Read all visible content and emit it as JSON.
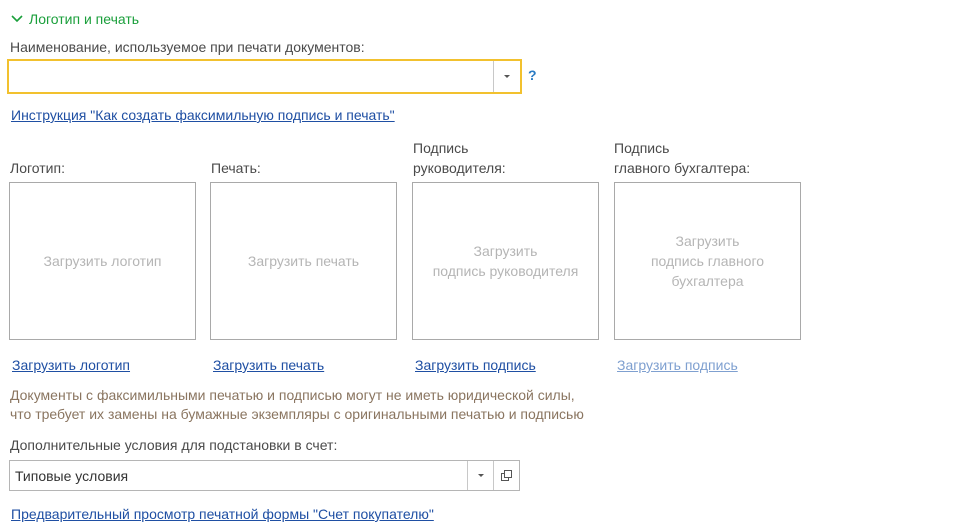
{
  "section": {
    "title": "Логотип и печать",
    "icon": "chevron-down-icon"
  },
  "name_field": {
    "label": "Наименование, используемое при печати документов:",
    "value": "",
    "help": "?"
  },
  "instruction_link": "Инструкция \"Как создать факсимильную подпись и печать\"",
  "images": [
    {
      "label": "Логотип:",
      "placeholder": "Загрузить логотип",
      "link": "Загрузить логотип"
    },
    {
      "label": "Печать:",
      "placeholder": "Загрузить печать",
      "link": "Загрузить печать"
    },
    {
      "label": "Подпись\nруководителя:",
      "placeholder": "Загрузить\nподпись руководителя",
      "link": "Загрузить подпись"
    },
    {
      "label": "Подпись\nглавного бухгалтера:",
      "placeholder": "Загрузить\nподпись главного\nбухгалтера",
      "link": "Загрузить подпись"
    }
  ],
  "note": {
    "line1": "Документы с факсимильными печатью и подписью могут не иметь юридической силы,",
    "line2": "что требует их замены на бумажные экземпляры с оригинальными печатью и подписью"
  },
  "conditions_field": {
    "label": "Дополнительные условия для подстановки в счет:",
    "value": "Типовые условия"
  },
  "preview_link": "Предварительный просмотр печатной формы \"Счет покупателю\"",
  "colors": {
    "accent_green": "#1a9f3b",
    "focus_border": "#f2c12e",
    "link": "#1f4fa3",
    "note": "#8a7560"
  }
}
